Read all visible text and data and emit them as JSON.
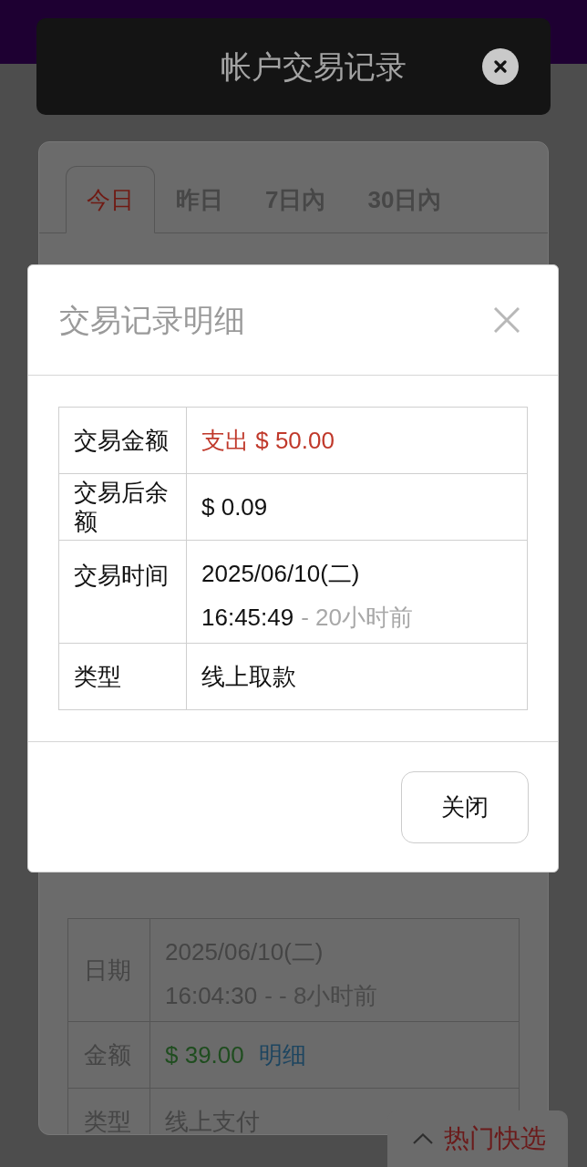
{
  "header": {
    "title": "帐户交易记录"
  },
  "tabs": [
    {
      "label": "今日",
      "selected": true
    },
    {
      "label": "昨日",
      "selected": false
    },
    {
      "label": "7日內",
      "selected": false
    },
    {
      "label": "30日內",
      "selected": false
    }
  ],
  "records": [
    {
      "rows": [
        {
          "kind": "datetime",
          "label": "日期",
          "date": "2025/06/10(二)",
          "time": "16:04:30",
          "relative": "- - 8小时前"
        },
        {
          "kind": "amount",
          "label": "金额",
          "value": "$ 39.00",
          "expense": false,
          "link": "明细"
        },
        {
          "kind": "text",
          "label": "类型",
          "value": "线上支付"
        }
      ]
    }
  ],
  "modal": {
    "title": "交易记录明细",
    "rows": [
      {
        "kind": "amount",
        "label": "交易金额",
        "value": "支出 $ 50.00",
        "expense": true
      },
      {
        "kind": "text",
        "label": "交易后余额",
        "value": "$ 0.09"
      },
      {
        "kind": "datetime",
        "label": "交易时间",
        "date": "2025/06/10(二)",
        "time": "16:45:49",
        "relative": "- 20小时前"
      },
      {
        "kind": "text",
        "label": "类型",
        "value": "线上取款"
      }
    ],
    "button": "关闭"
  },
  "quick_select": {
    "label": "热门快选"
  }
}
